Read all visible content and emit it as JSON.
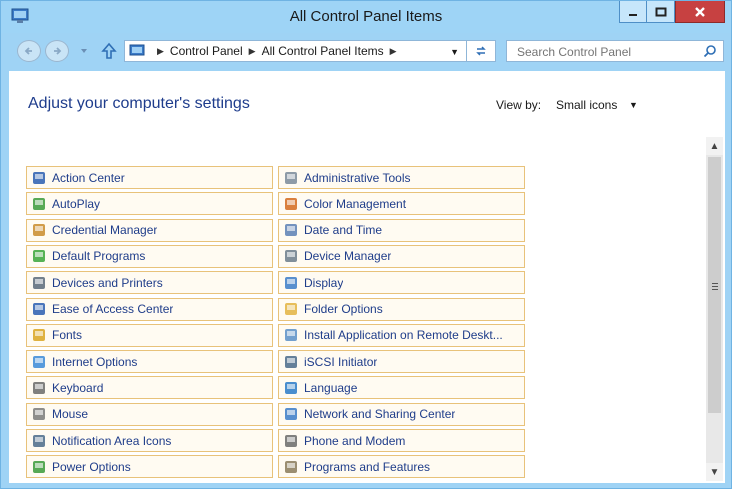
{
  "window": {
    "title": "All Control Panel Items",
    "close_glyph": "✕",
    "min_glyph": "▁",
    "max_glyph": "□"
  },
  "navbar": {
    "breadcrumb": [
      "Control Panel",
      "All Control Panel Items"
    ],
    "search_placeholder": "Search Control Panel"
  },
  "content": {
    "heading": "Adjust your computer's settings",
    "view_by_label": "View by:",
    "view_by_value": "Small icons"
  },
  "items": [
    {
      "label": "Action Center",
      "icon": "flag-icon"
    },
    {
      "label": "Administrative Tools",
      "icon": "admin-tools-icon"
    },
    {
      "label": "AutoPlay",
      "icon": "autoplay-icon"
    },
    {
      "label": "Color Management",
      "icon": "color-management-icon"
    },
    {
      "label": "Credential Manager",
      "icon": "credential-icon"
    },
    {
      "label": "Date and Time",
      "icon": "clock-icon"
    },
    {
      "label": "Default Programs",
      "icon": "default-programs-icon"
    },
    {
      "label": "Device Manager",
      "icon": "device-manager-icon"
    },
    {
      "label": "Devices and Printers",
      "icon": "printer-icon"
    },
    {
      "label": "Display",
      "icon": "monitor-icon"
    },
    {
      "label": "Ease of Access Center",
      "icon": "ease-of-access-icon"
    },
    {
      "label": "Folder Options",
      "icon": "folder-icon"
    },
    {
      "label": "Fonts",
      "icon": "fonts-icon"
    },
    {
      "label": "Install Application on Remote Deskt...",
      "icon": "remote-desktop-icon"
    },
    {
      "label": "Internet Options",
      "icon": "internet-icon"
    },
    {
      "label": "iSCSI Initiator",
      "icon": "iscsi-icon"
    },
    {
      "label": "Keyboard",
      "icon": "keyboard-icon"
    },
    {
      "label": "Language",
      "icon": "language-icon"
    },
    {
      "label": "Mouse",
      "icon": "mouse-icon"
    },
    {
      "label": "Network and Sharing Center",
      "icon": "network-icon"
    },
    {
      "label": "Notification Area Icons",
      "icon": "notification-icon"
    },
    {
      "label": "Phone and Modem",
      "icon": "phone-icon"
    },
    {
      "label": "Power Options",
      "icon": "power-icon"
    },
    {
      "label": "Programs and Features",
      "icon": "programs-icon"
    }
  ]
}
